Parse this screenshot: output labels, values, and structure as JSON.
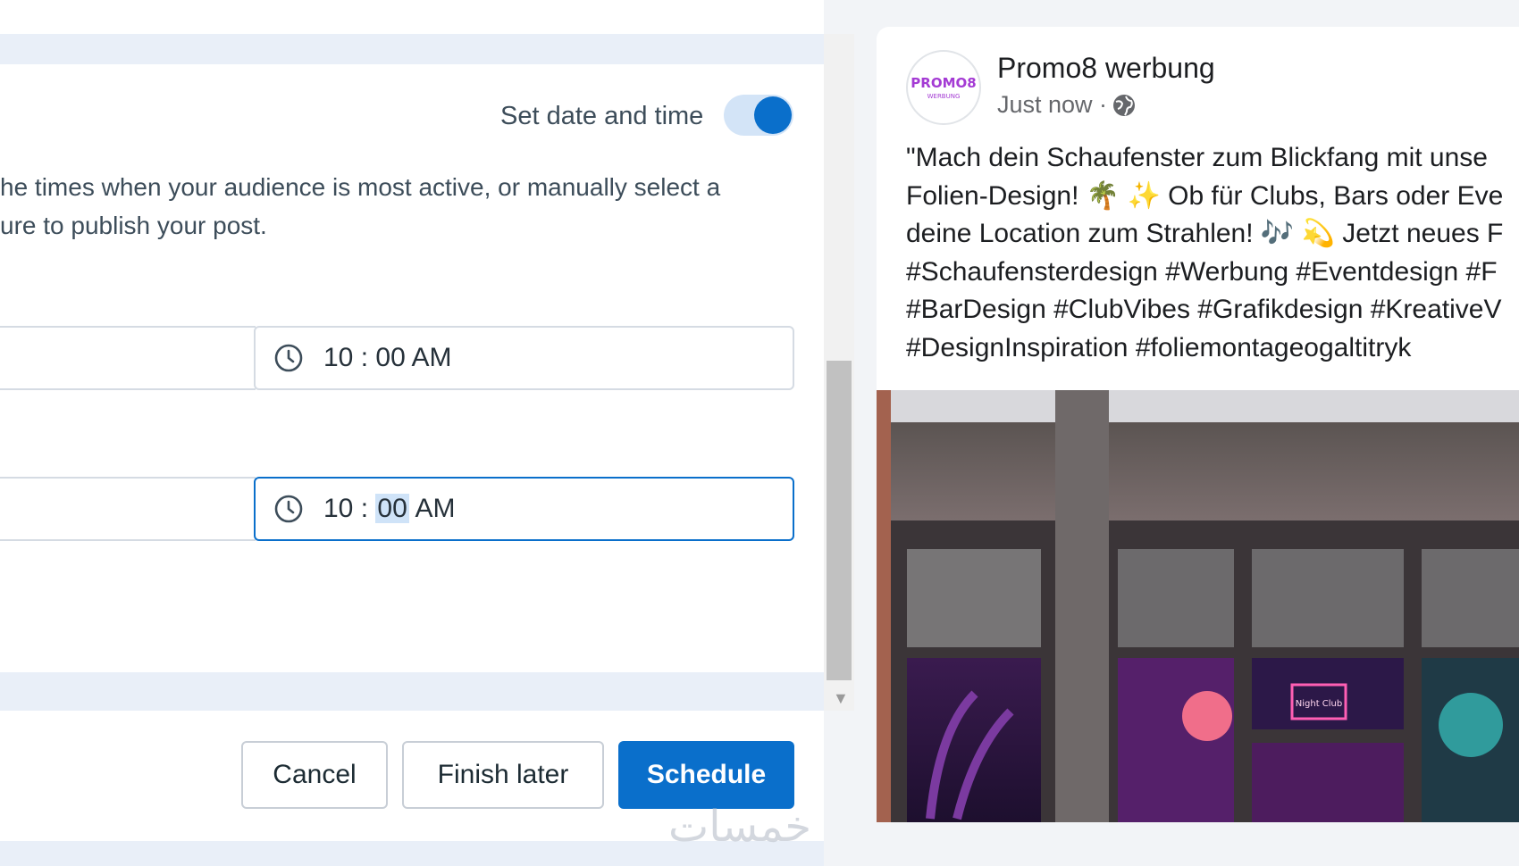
{
  "schedule": {
    "toggle_label": "Set date and time",
    "toggle_on": true,
    "description_line1": "he times when your audience is most active, or manually select a",
    "description_line2": "ure to publish your post.",
    "time_1": {
      "hour": "10",
      "sep": " : ",
      "minute": "00",
      "period": "AM"
    },
    "time_2": {
      "hour": "10",
      "sep": " : ",
      "minute": "00",
      "period": "AM"
    }
  },
  "footer": {
    "cancel_label": "Cancel",
    "finish_later_label": "Finish later",
    "schedule_label": "Schedule"
  },
  "preview": {
    "page_name": "Promo8 werbung",
    "post_time": "Just now ·",
    "avatar_text": "PROMO8",
    "avatar_subtext": "WERBUNG",
    "text_lines": [
      "\"Mach dein Schaufenster zum Blickfang mit unse",
      "Folien-Design! 🌴 ✨ Ob für Clubs, Bars oder Eve",
      "deine Location zum Strahlen! 🎶 💫 Jetzt neues F",
      "#Schaufensterdesign #Werbung #Eventdesign #F",
      "#BarDesign #ClubVibes #Grafikdesign #KreativeV",
      "#DesignInspiration #foliemontageogaltitryk"
    ],
    "image_sign": "Night Club"
  },
  "watermark": "خمسات",
  "colors": {
    "accent": "#0a6fcb",
    "toggle_track": "#d3e4f7",
    "page_bg": "#e9eff8"
  },
  "icons": {
    "clock": "clock-icon",
    "globe": "globe-icon",
    "scroll_down": "chevron-down-icon"
  }
}
